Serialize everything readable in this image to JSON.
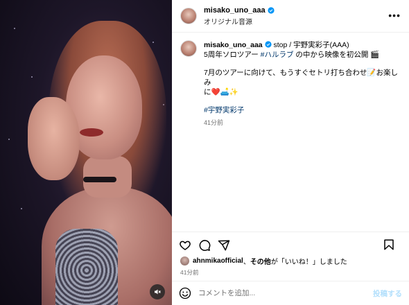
{
  "header": {
    "username": "misako_uno_aaa",
    "subtitle": "オリジナル音源",
    "more_label": "•••"
  },
  "caption": {
    "username": "misako_uno_aaa",
    "line1_suffix": "stop / 宇野実彩子(AAA)",
    "line2_prefix": "5周年ソロツアー",
    "line2_hashtag": "#ハルラブ",
    "line2_suffix": "の中から映像を初公開",
    "line2_emoji": "🎬",
    "para2_line1_prefix": "7月のツアーに向けて、もうすぐセトリ打ち合わせ",
    "para2_line1_emoji": "📝",
    "para2_line1_suffix": "お楽しみ",
    "para2_line2_prefix": "に",
    "para2_line2_emojis": "❤️🛋️✨",
    "hashtag": "#宇野実彩子",
    "time": "41分前"
  },
  "likes": {
    "user": "ahnmikaofficial",
    "separator": "、",
    "others": "その他",
    "suffix": "が「いいね！」しました"
  },
  "post_time": "41分前",
  "comment": {
    "placeholder": "コメントを追加...",
    "post_label": "投稿する"
  },
  "colors": {
    "hashtag": "#00376b",
    "verified": "#0095f6",
    "post_disabled": "#b2dffc",
    "muted_text": "#737373"
  },
  "icons": [
    "verified-badge-icon",
    "more-icon",
    "heart-icon",
    "comment-icon",
    "share-icon",
    "bookmark-icon",
    "emoji-icon",
    "mute-icon"
  ]
}
